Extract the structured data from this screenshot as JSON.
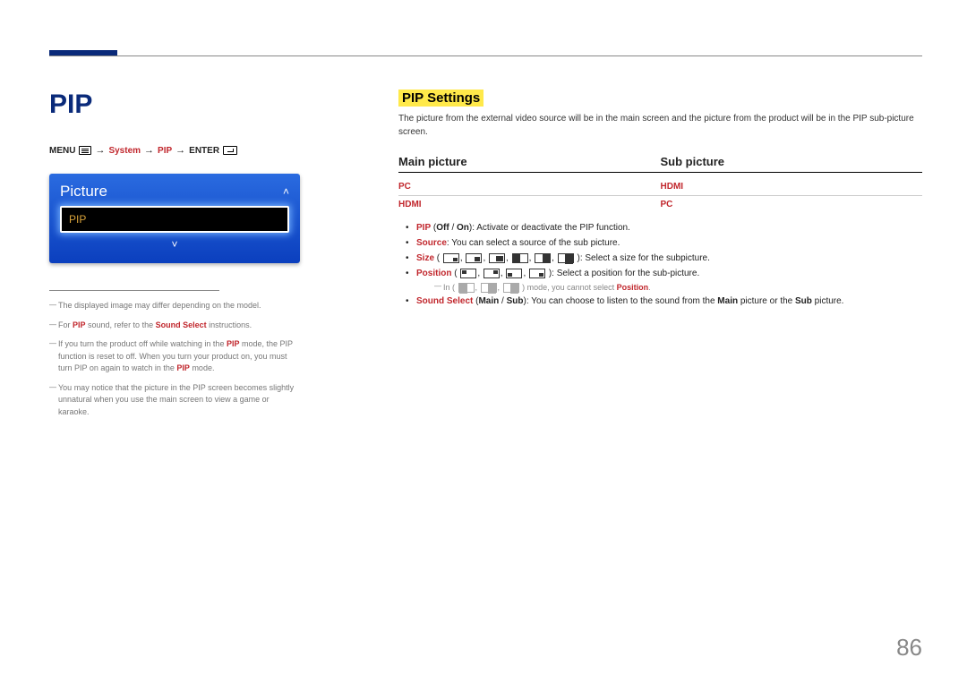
{
  "page_number": "86",
  "heading": "PIP",
  "menu_path": {
    "menu": "MENU",
    "system": "System",
    "pip": "PIP",
    "enter": "ENTER"
  },
  "osd": {
    "panel_title": "Picture",
    "selected_item": "PIP"
  },
  "left_notes": {
    "n1": "The displayed image may differ depending on the model.",
    "n2_a": "For ",
    "n2_pip": "PIP",
    "n2_b": " sound, refer to the ",
    "n2_ss": "Sound Select",
    "n2_c": " instructions.",
    "n3_a": "If you turn the product off while watching in the ",
    "n3_pip": "PIP",
    "n3_b": " mode, the PIP function is reset to off. When you turn your product on, you must turn PIP on again to watch in the ",
    "n3_pip2": "PIP",
    "n3_c": " mode.",
    "n4": "You may notice that the picture in the PIP screen becomes slightly unnatural when you use the main screen to view a game or karaoke."
  },
  "settings_heading": "PIP Settings",
  "settings_intro": "The picture from the external video source will be in the main screen and the picture from the product will be in the PIP sub-picture screen.",
  "table": {
    "col1": "Main picture",
    "col2": "Sub picture",
    "rows": [
      {
        "main": "PC",
        "sub": "HDMI"
      },
      {
        "main": "HDMI",
        "sub": "PC"
      }
    ]
  },
  "bullets": {
    "b1_a": "PIP",
    "b1_b": " (",
    "b1_c": "Off",
    "b1_d": " / ",
    "b1_e": "On",
    "b1_f": "): Activate or deactivate the PIP function.",
    "b2_a": "Source",
    "b2_b": ": You can select a source of the sub picture.",
    "b3_a": "Size",
    "b3_b": ": Select a size for the subpicture.",
    "b4_a": "Position",
    "b4_b": " (",
    "b4_c": "): Select a position for the sub-picture.",
    "b4_note_a": "In (",
    "b4_note_b": ") mode, you cannot select ",
    "b4_note_c": "Position",
    "b4_note_d": ".",
    "b5_a": "Sound Select",
    "b5_b": " (",
    "b5_c": "Main",
    "b5_d": " / ",
    "b5_e": "Sub",
    "b5_f": "): You can choose to listen to the sound from the ",
    "b5_g": "Main",
    "b5_h": " picture or the ",
    "b5_i": "Sub",
    "b5_j": " picture."
  }
}
